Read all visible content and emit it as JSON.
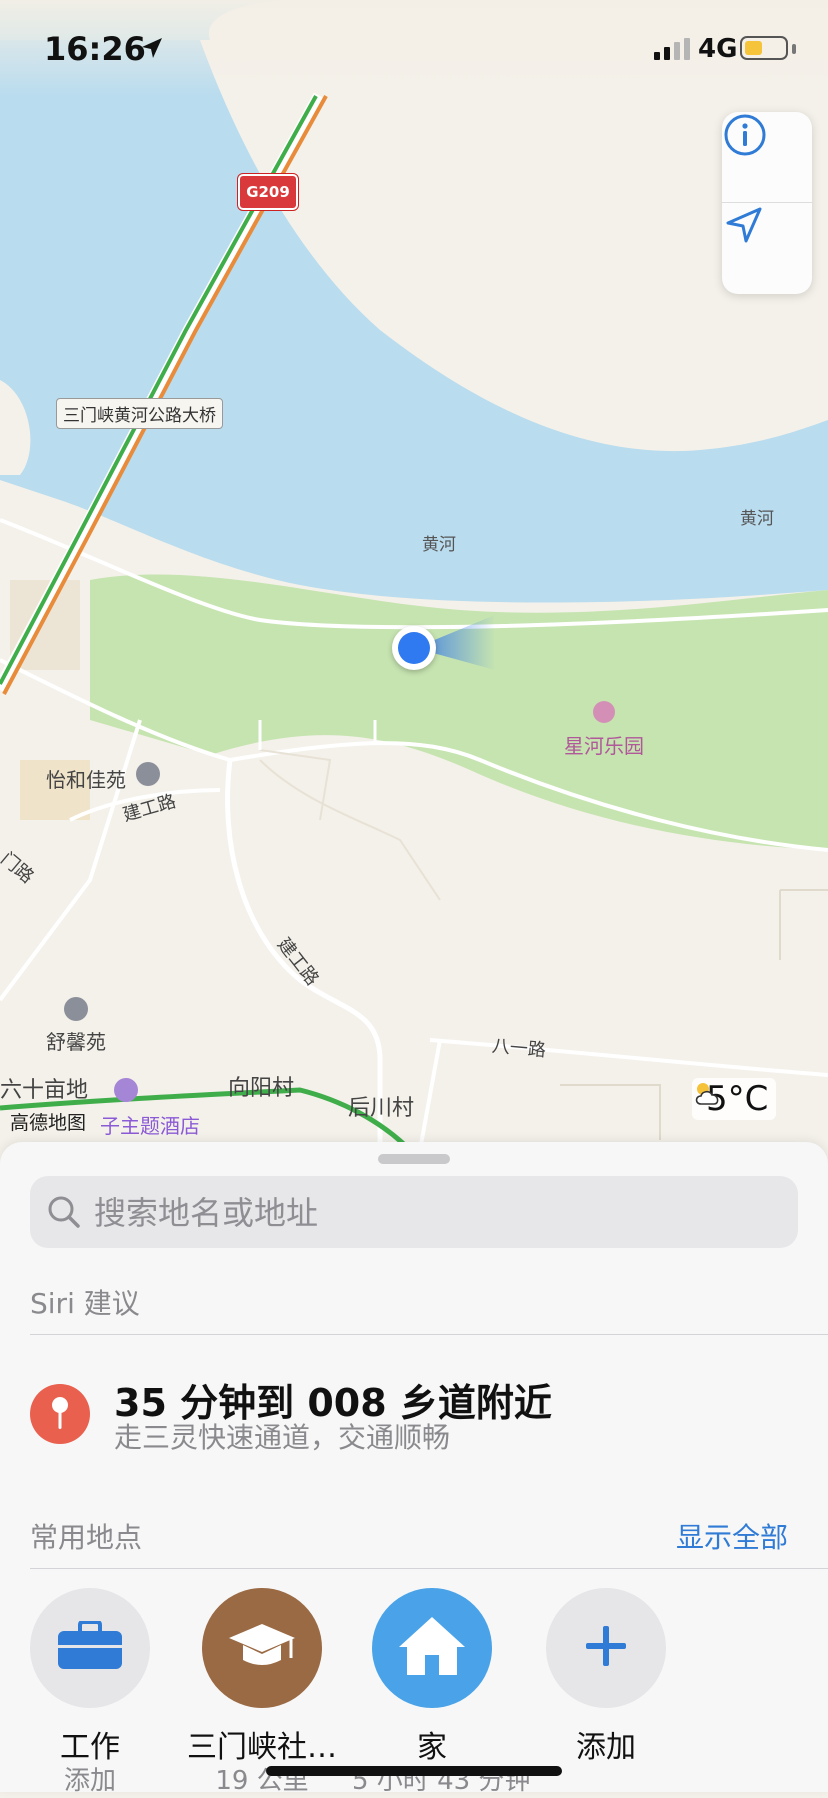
{
  "status_bar": {
    "time": "16:26",
    "network": "4G",
    "battery_level": 0.45
  },
  "map": {
    "highway_shield": "G209",
    "bridge_label": "三门峡黄河公路大桥",
    "river_labels": [
      "黄河",
      "黄河"
    ],
    "park_label": "星河乐园",
    "poi_labels": [
      "怡和佳苑",
      "舒馨苑",
      "六十亩地",
      "子主题酒店"
    ],
    "road_labels": [
      "建工路",
      "建工路",
      "八一路",
      "门路"
    ],
    "village_labels": [
      "向阳村",
      "后川村"
    ],
    "attribution": "高德地图",
    "weather": "5°C"
  },
  "sheet": {
    "search_placeholder": "搜索地名或地址",
    "siri_title": "Siri 建议",
    "suggestion_title": "35 分钟到 008 乡道附近",
    "suggestion_sub": "走三灵快速通道，交通顺畅",
    "favorites_title": "常用地点",
    "show_all": "显示全部",
    "favorites": [
      {
        "name": "工作",
        "detail": "添加",
        "color": "#e6e6e9",
        "icon": "briefcase-icon"
      },
      {
        "name": "三门峡社…",
        "detail": "19 公里",
        "color": "#9a6a44",
        "icon": "graduation-cap-icon"
      },
      {
        "name": "家",
        "detail": "5 小时 43 分钟",
        "color": "#4aa3e8",
        "icon": "house-icon"
      },
      {
        "name": "添加",
        "detail": "",
        "color": "#e6e6e9",
        "icon": "plus-icon"
      }
    ]
  },
  "colors": {
    "accent": "#2f7bd6",
    "water": "#b9dcee",
    "park": "#c6e4b0",
    "land": "#f4f1ea",
    "user_dot": "#2f7af0"
  }
}
